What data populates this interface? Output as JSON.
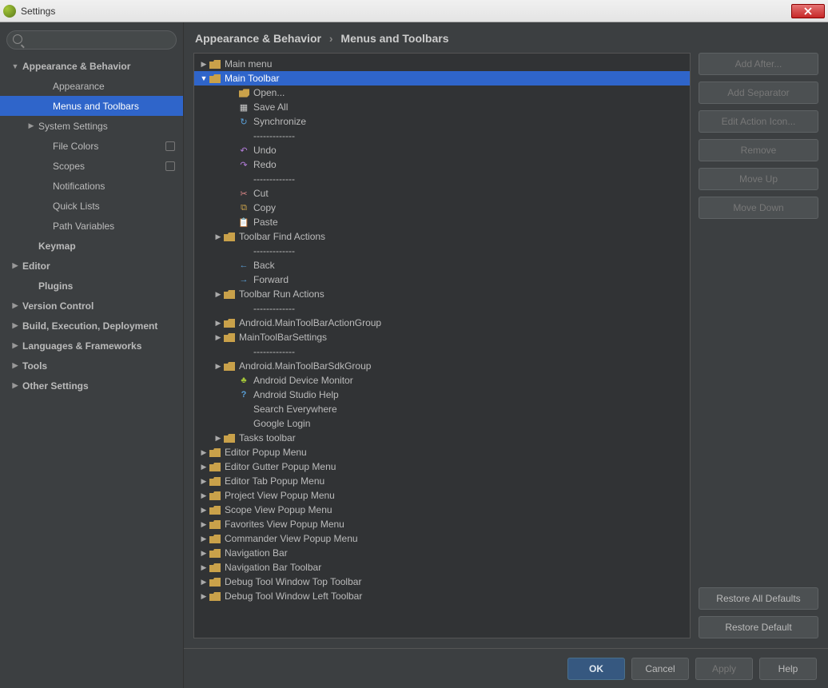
{
  "window": {
    "title": "Settings"
  },
  "search": {
    "placeholder": ""
  },
  "nav": [
    {
      "label": "Appearance & Behavior",
      "expand": "down",
      "bold": true,
      "level": 0
    },
    {
      "label": "Appearance",
      "level": 2
    },
    {
      "label": "Menus and Toolbars",
      "level": 2,
      "selected": true
    },
    {
      "label": "System Settings",
      "expand": "right",
      "level": 1
    },
    {
      "label": "File Colors",
      "level": 2,
      "badge": true
    },
    {
      "label": "Scopes",
      "level": 2,
      "badge": true
    },
    {
      "label": "Notifications",
      "level": 2
    },
    {
      "label": "Quick Lists",
      "level": 2
    },
    {
      "label": "Path Variables",
      "level": 2
    },
    {
      "label": "Keymap",
      "bold": true,
      "level": 1
    },
    {
      "label": "Editor",
      "expand": "right",
      "bold": true,
      "level": 0
    },
    {
      "label": "Plugins",
      "bold": true,
      "level": 1
    },
    {
      "label": "Version Control",
      "expand": "right",
      "bold": true,
      "level": 0
    },
    {
      "label": "Build, Execution, Deployment",
      "expand": "right",
      "bold": true,
      "level": 0
    },
    {
      "label": "Languages & Frameworks",
      "expand": "right",
      "bold": true,
      "level": 0
    },
    {
      "label": "Tools",
      "expand": "right",
      "bold": true,
      "level": 0
    },
    {
      "label": "Other Settings",
      "expand": "right",
      "bold": true,
      "level": 0
    }
  ],
  "breadcrumb": {
    "a": "Appearance & Behavior",
    "b": "Menus and Toolbars"
  },
  "tree": [
    {
      "indent": 0,
      "arrow": "right",
      "icon": "folder",
      "label": "Main menu"
    },
    {
      "indent": 0,
      "arrow": "down",
      "icon": "folder",
      "label": "Main Toolbar",
      "selected": true
    },
    {
      "indent": 2,
      "icon": "open",
      "label": "Open..."
    },
    {
      "indent": 2,
      "icon": "saveall",
      "label": "Save All"
    },
    {
      "indent": 2,
      "icon": "sync",
      "label": "Synchronize"
    },
    {
      "indent": 2,
      "icon": "sep",
      "label": "-------------"
    },
    {
      "indent": 2,
      "icon": "undo",
      "label": "Undo"
    },
    {
      "indent": 2,
      "icon": "redo",
      "label": "Redo"
    },
    {
      "indent": 2,
      "icon": "sep",
      "label": "-------------"
    },
    {
      "indent": 2,
      "icon": "cut",
      "label": "Cut"
    },
    {
      "indent": 2,
      "icon": "copy",
      "label": "Copy"
    },
    {
      "indent": 2,
      "icon": "paste",
      "label": "Paste"
    },
    {
      "indent": 1,
      "arrow": "right",
      "icon": "folder",
      "label": "Toolbar Find Actions"
    },
    {
      "indent": 2,
      "icon": "sep",
      "label": "-------------"
    },
    {
      "indent": 2,
      "icon": "back",
      "label": "Back"
    },
    {
      "indent": 2,
      "icon": "forward",
      "label": "Forward"
    },
    {
      "indent": 1,
      "arrow": "right",
      "icon": "folder",
      "label": "Toolbar Run Actions"
    },
    {
      "indent": 2,
      "icon": "sep",
      "label": "-------------"
    },
    {
      "indent": 1,
      "arrow": "right",
      "icon": "folder",
      "label": "Android.MainToolBarActionGroup"
    },
    {
      "indent": 1,
      "arrow": "right",
      "icon": "folder",
      "label": "MainToolBarSettings"
    },
    {
      "indent": 2,
      "icon": "sep",
      "label": "-------------"
    },
    {
      "indent": 1,
      "arrow": "right",
      "icon": "folder",
      "label": "Android.MainToolBarSdkGroup"
    },
    {
      "indent": 2,
      "icon": "android",
      "label": "Android Device Monitor"
    },
    {
      "indent": 2,
      "icon": "help",
      "label": "Android Studio Help"
    },
    {
      "indent": 2,
      "icon": "none",
      "label": "Search Everywhere"
    },
    {
      "indent": 2,
      "icon": "none",
      "label": "Google Login"
    },
    {
      "indent": 1,
      "arrow": "right",
      "icon": "folder",
      "label": "Tasks toolbar"
    },
    {
      "indent": 0,
      "arrow": "right",
      "icon": "folder",
      "label": "Editor Popup Menu"
    },
    {
      "indent": 0,
      "arrow": "right",
      "icon": "folder",
      "label": "Editor Gutter Popup Menu"
    },
    {
      "indent": 0,
      "arrow": "right",
      "icon": "folder",
      "label": "Editor Tab Popup Menu"
    },
    {
      "indent": 0,
      "arrow": "right",
      "icon": "folder",
      "label": "Project View Popup Menu"
    },
    {
      "indent": 0,
      "arrow": "right",
      "icon": "folder",
      "label": "Scope View Popup Menu"
    },
    {
      "indent": 0,
      "arrow": "right",
      "icon": "folder",
      "label": "Favorites View Popup Menu"
    },
    {
      "indent": 0,
      "arrow": "right",
      "icon": "folder",
      "label": "Commander View Popup Menu"
    },
    {
      "indent": 0,
      "arrow": "right",
      "icon": "folder",
      "label": "Navigation Bar"
    },
    {
      "indent": 0,
      "arrow": "right",
      "icon": "folder",
      "label": "Navigation Bar Toolbar"
    },
    {
      "indent": 0,
      "arrow": "right",
      "icon": "folder",
      "label": "Debug Tool Window Top Toolbar"
    },
    {
      "indent": 0,
      "arrow": "right",
      "icon": "folder",
      "label": "Debug Tool Window Left Toolbar"
    }
  ],
  "buttons": {
    "add_after": "Add After...",
    "add_separator": "Add Separator",
    "edit_icon": "Edit Action Icon...",
    "remove": "Remove",
    "move_up": "Move Up",
    "move_down": "Move Down",
    "restore_all": "Restore All Defaults",
    "restore": "Restore Default",
    "ok": "OK",
    "cancel": "Cancel",
    "apply": "Apply",
    "help": "Help"
  }
}
